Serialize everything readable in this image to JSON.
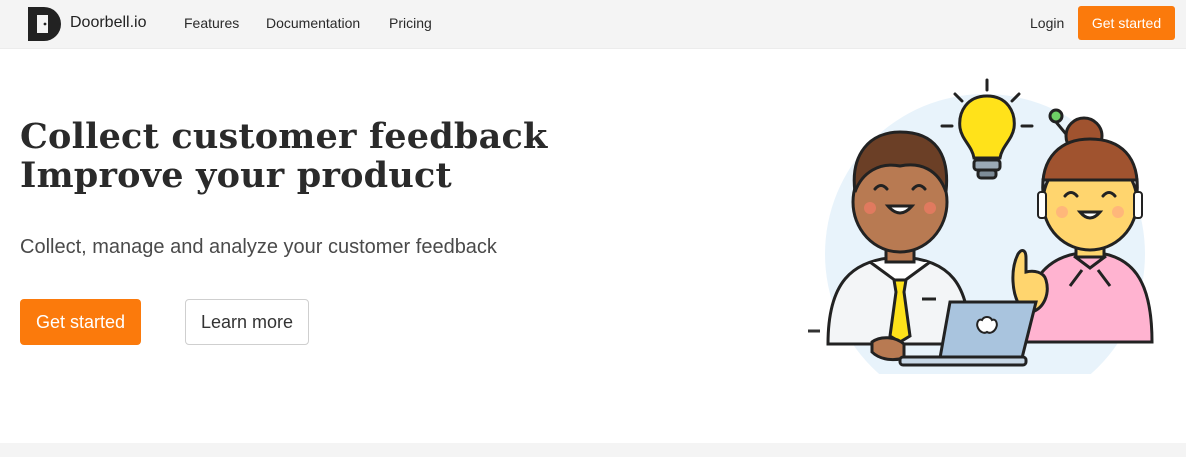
{
  "nav": {
    "brand": "Doorbell.io",
    "links": [
      "Features",
      "Documentation",
      "Pricing"
    ],
    "login": "Login",
    "cta": "Get started"
  },
  "hero": {
    "title_line1": "Collect customer feedback",
    "title_line2": "Improve your product",
    "subtitle": "Collect, manage and analyze your customer feedback",
    "primary_button": "Get started",
    "secondary_button": "Learn more"
  },
  "colors": {
    "accent": "#fb7a0c",
    "nav_background": "#f4f4f4"
  },
  "icons": {
    "logo": "doorbell-logo-icon",
    "illustration": "team-idea-illustration"
  }
}
